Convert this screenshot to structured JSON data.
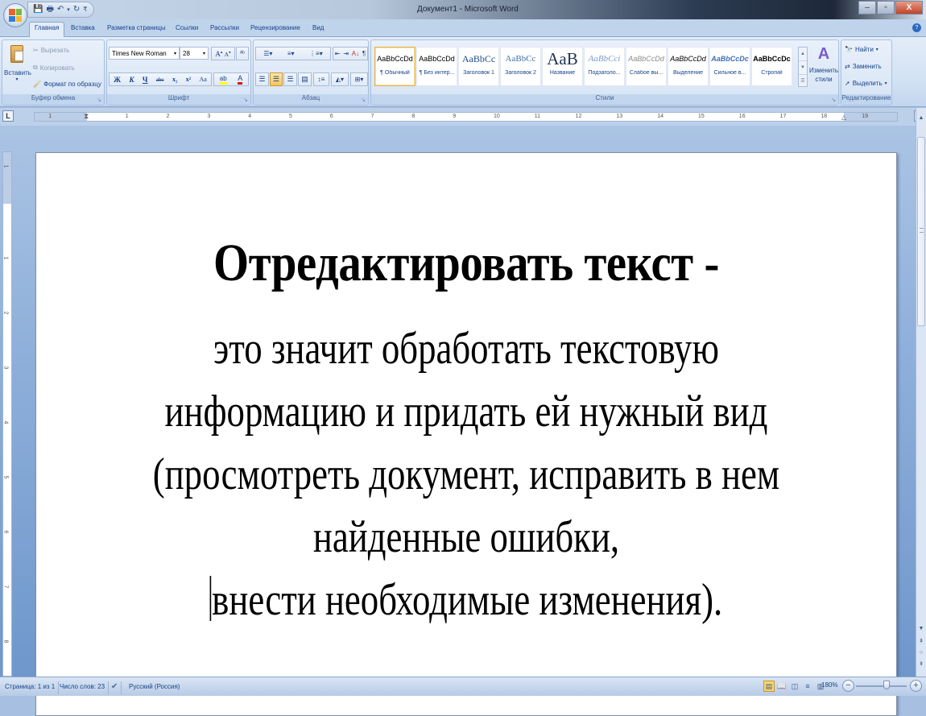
{
  "window": {
    "title": "Документ1 - Microsoft Word",
    "controls": {
      "minimize": "–",
      "maximize": "▫",
      "close": "X"
    }
  },
  "quick_access": {
    "save_icon": "floppy-disk-icon",
    "print_icon": "printer-icon",
    "undo_icon": "undo-icon",
    "redo_icon": "redo-icon",
    "customize_icon": "customize-toolbar-icon"
  },
  "tabs": [
    {
      "label": "Главная",
      "active": true
    },
    {
      "label": "Вставка"
    },
    {
      "label": "Разметка страницы"
    },
    {
      "label": "Ссылки"
    },
    {
      "label": "Рассылки"
    },
    {
      "label": "Рецензирование"
    },
    {
      "label": "Вид"
    }
  ],
  "ribbon": {
    "clipboard": {
      "label": "Буфер обмена",
      "paste": "Вставить",
      "cut": "Вырезать",
      "copy": "Копировать",
      "format_painter": "Формат по образцу"
    },
    "font": {
      "label": "Шрифт",
      "font_name": "Times New Roman",
      "font_size": "28",
      "grow": "A",
      "shrink": "A",
      "clear": "Aa",
      "bold": "Ж",
      "italic": "К",
      "underline": "Ч",
      "strike": "abc",
      "subscript": "x₂",
      "superscript": "x²",
      "change_case": "Aa",
      "highlight_color": "#ffff00",
      "font_color": "#e01010"
    },
    "paragraph": {
      "label": "Абзац",
      "alignment_selected": "center"
    },
    "styles": {
      "label": "Стили",
      "items": [
        {
          "sample": "AaBbCcDd",
          "name": "¶ Обычный",
          "selected": true
        },
        {
          "sample": "AaBbCcDd",
          "name": "¶ Без интер..."
        },
        {
          "sample": "AaBbCc",
          "name": "Заголовок 1"
        },
        {
          "sample": "AaBbCc",
          "name": "Заголовок 2"
        },
        {
          "sample": "AaB",
          "name": "Название"
        },
        {
          "sample": "AaBbCci",
          "name": "Подзаголо..."
        },
        {
          "sample": "AaBbCcDd",
          "name": "Слабое вы..."
        },
        {
          "sample": "AaBbCcDd",
          "name": "Выделение"
        },
        {
          "sample": "AaBbCcDc",
          "name": "Сильное в..."
        },
        {
          "sample": "AaBbCcDc",
          "name": "Строгий"
        }
      ],
      "change_styles": "Изменить стили"
    },
    "editing": {
      "label": "Редактирование",
      "find": "Найти",
      "replace": "Заменить",
      "select": "Выделить"
    }
  },
  "ruler": {
    "tab_selector": "L",
    "numbers": [
      "1",
      "1",
      "2",
      "3",
      "4",
      "5",
      "6",
      "7",
      "8",
      "9",
      "10",
      "11",
      "12",
      "13",
      "14",
      "15",
      "16",
      "17",
      "18",
      "19"
    ],
    "vertical_numbers": [
      "1",
      "1",
      "2",
      "3",
      "4",
      "5",
      "6",
      "7",
      "8"
    ]
  },
  "document": {
    "heading": "Отредактировать текст -",
    "lines": [
      "это значит обработать текстовую",
      "информацию и придать ей нужный вид",
      "(просмотреть документ, исправить в нем",
      "найденные ошибки,",
      "внести необходимые изменения)."
    ]
  },
  "status": {
    "page": "Страница: 1 из 1",
    "words": "Число слов: 23",
    "proofing_icon": "spell-check-icon",
    "language": "Русский (Россия)",
    "zoom": "180%",
    "zoom_value_percent": 180
  }
}
